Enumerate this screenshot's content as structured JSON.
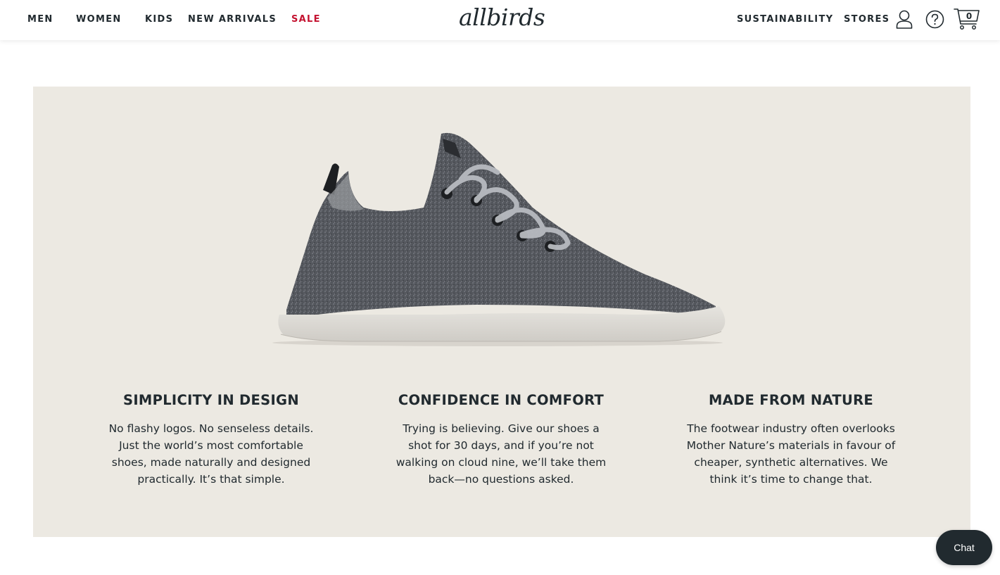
{
  "brand": {
    "logo_text": "allbirds",
    "text_color": "#212a2f",
    "sale_color": "#c41230",
    "panel_color": "#ece9e2"
  },
  "nav": {
    "left": [
      {
        "label": "MEN"
      },
      {
        "label": "WOMEN"
      },
      {
        "label": "KIDS"
      },
      {
        "label": "NEW ARRIVALS"
      },
      {
        "label": "SALE"
      }
    ],
    "right": [
      {
        "label": "SUSTAINABILITY"
      },
      {
        "label": "STORES"
      }
    ],
    "icons": [
      "account-icon",
      "help-icon",
      "cart-icon"
    ],
    "cart_count": "0"
  },
  "features": [
    {
      "title": "SIMPLICITY IN DESIGN",
      "body": "No flashy logos. No senseless details. Just the world’s most comfortable shoes, made naturally and designed practically. It’s that simple."
    },
    {
      "title": "CONFIDENCE IN COMFORT",
      "body": "Trying is believing. Give our shoes a shot for 30 days, and if you’re not walking on cloud nine, we’ll take them back—no questions asked."
    },
    {
      "title": "MADE FROM NATURE",
      "body": "The footwear industry often overlooks Mother Nature’s materials in favour of cheaper, synthetic alternatives. We think it’s time to change that."
    }
  ],
  "chat": {
    "label": "Chat"
  }
}
